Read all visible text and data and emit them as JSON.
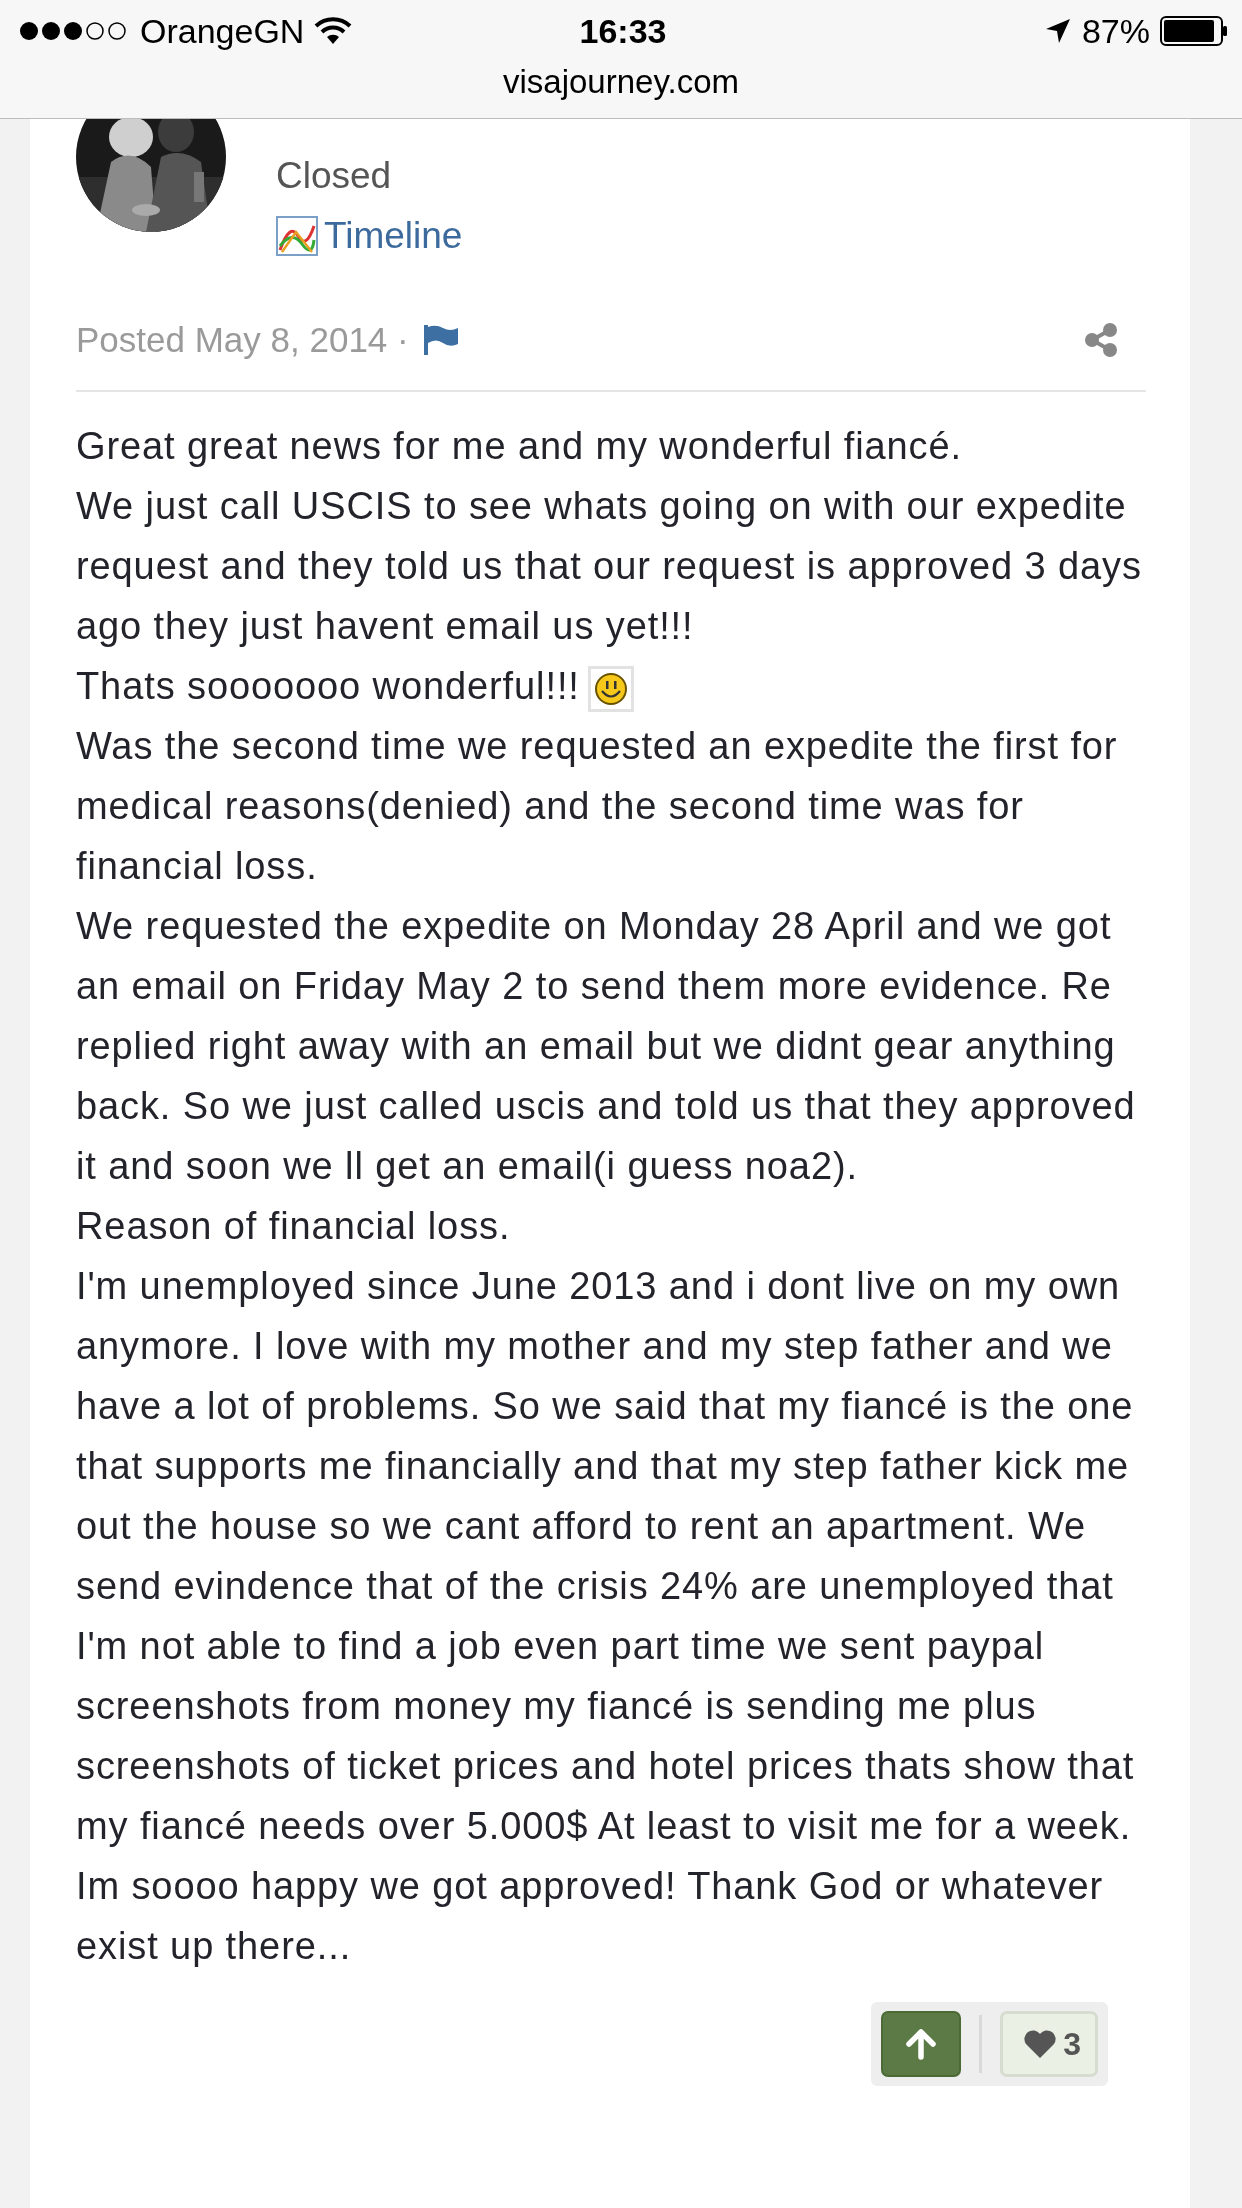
{
  "status_bar": {
    "carrier": "OrangeGN",
    "time": "16:33",
    "battery": "87%"
  },
  "address_bar": {
    "url": "visajourney.com"
  },
  "post": {
    "status": "Closed",
    "timeline_link": "Timeline",
    "posted": "Posted May 8, 2014 ·",
    "paragraphs": [
      {
        "text": "Great great news for me and my wonderful fiancé."
      },
      {
        "text": "We just call USCIS to see whats going on with our expedite request and they told us that our request is approved 3 days ago they just havent email us yet!!!"
      },
      {
        "text": "Thats sooooooo wonderful!!!",
        "smiley": true
      },
      {
        "text": "Was the second time we requested an expedite the first for medical reasons(denied) and the second time was for financial loss."
      },
      {
        "text": "We requested the expedite on Monday 28 April and we got an email on Friday May 2 to send them more evidence. Re replied right away with an email but we didnt gear anything back. So we just called uscis and told us that they approved it and soon we ll get an email(i guess noa2)."
      },
      {
        "text": "Reason of financial loss."
      },
      {
        "text": "I'm unemployed since June 2013 and i dont live on my own anymore. I love with my mother and my step father and we have a lot of problems. So we said that my fiancé is the one that supports me financially and that my step father kick me out the house so we cant afford to rent an apartment. We send evindence that of the crisis 24% are unemployed that I'm not able to find a job even part time we sent paypal screenshots from money my fiancé is sending me plus screenshots of ticket prices and hotel prices thats show that my fiancé needs over 5.000$ At least to visit me for a week."
      },
      {
        "text": "Im soooo happy we got approved! Thank God or whatever exist up there..."
      }
    ],
    "reactions": {
      "count": "3"
    }
  }
}
